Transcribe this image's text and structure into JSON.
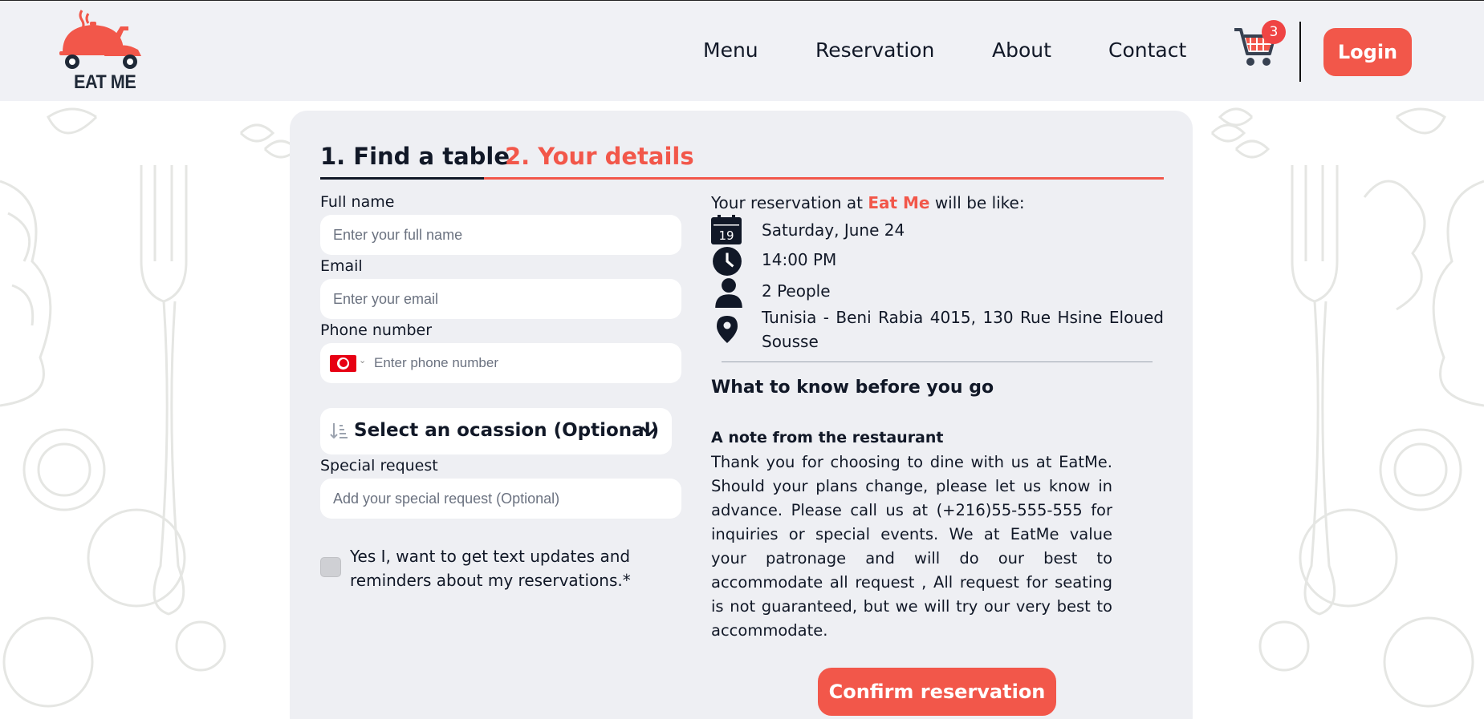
{
  "header": {
    "logo_text": "EAT ME",
    "nav": [
      "Menu",
      "Reservation",
      "About",
      "Contact"
    ],
    "cart_count": "3",
    "login_label": "Login"
  },
  "tabs": {
    "find_table": "1. Find a table",
    "your_details": "2. Your details"
  },
  "form": {
    "full_name_label": "Full name",
    "full_name_placeholder": "Enter your full name",
    "email_label": "Email",
    "email_placeholder": "Enter your email",
    "phone_label": "Phone number",
    "phone_placeholder": "Enter phone number",
    "occasion_label": "Select an ocassion (Optional)",
    "special_label": "Special request",
    "special_placeholder": "Add your special request (Optional)",
    "checkbox_label": "Yes I, want to get text updates and reminders about my reservations.*"
  },
  "summary": {
    "prefix": "Your reservation at ",
    "brand": "Eat Me",
    "suffix": " will be like:",
    "calendar_day": "19",
    "date": "Saturday, June 24",
    "time": "14:00 PM",
    "people": "2 People",
    "location": "Tunisia - Beni Rabia 4015, 130 Rue Hsine Eloued Sousse"
  },
  "know": {
    "title": "What to know before you go",
    "note_title": "A note from the restaurant",
    "note_text": "Thank you for choosing to dine with us at EatMe. Should your plans change, please let us know in advance. Please call us at (+216)55-555-555 for inquiries or special events. We at EatMe value your patronage and will do our best to accommodate all request , All request for seating is not guaranteed, but we will try our very best to accommodate."
  },
  "confirm_label": "Confirm reservation",
  "colors": {
    "accent": "#f2574a",
    "header_bg": "#f0f1f5",
    "card_bg": "#eeeff3",
    "text": "#111827"
  }
}
